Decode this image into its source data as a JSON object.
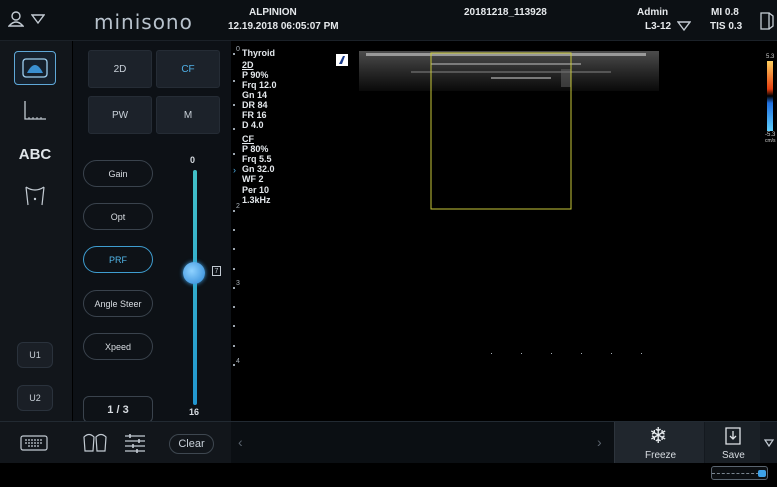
{
  "header": {
    "logo": "minisono",
    "company": "ALPINION",
    "datetime": "12.19.2018  06:05:07 PM",
    "study_id": "20181218_113928",
    "user": "Admin",
    "probe": "L3-12",
    "mi": "MI 0.8",
    "tis": "TIS 0.3"
  },
  "left_toolbar": {
    "abc_label": "ABC",
    "u1_label": "U1",
    "u2_label": "U2"
  },
  "modes": [
    "2D",
    "CF",
    "PW",
    "M"
  ],
  "controls": {
    "gain": "Gain",
    "opt": "Opt",
    "prf": "PRF",
    "angle_steer": "Angle Steer",
    "xpeed": "Xpeed",
    "page": "1 / 3",
    "depth_top": "0",
    "depth_bottom": "16",
    "slider_value_icon": "7"
  },
  "params": {
    "preset": "Thyroid",
    "p2d_title": "2D",
    "p2d_p": "P 90%",
    "p2d_frq": "Frq 12.0",
    "p2d_gn": "Gn 14",
    "p2d_dr": "DR 84",
    "p2d_fr": "FR 16",
    "p2d_d": "D 4.0",
    "cf_title": "CF",
    "cf_p": "P 80%",
    "cf_frq": "Frq 5.5",
    "cf_gn": "Gn 32.0",
    "cf_wf": "WF 2",
    "cf_per": "Per 10",
    "cf_prf": "1.3kHz",
    "depth_1": "0",
    "depth_2": "2",
    "depth_3": "3",
    "depth_4": "4"
  },
  "colorbar": {
    "top": "5.3",
    "bottom": "-5.3",
    "unit": "cm/s"
  },
  "bottom": {
    "clear": "Clear",
    "freeze": "Freeze",
    "save": "Save"
  },
  "colors": {
    "accent": "#3e9dd0",
    "roi_box": "#c8c83a",
    "slider": "#2aa7c0"
  },
  "icons": [
    "user-icon",
    "chevron-down-icon",
    "probe-icon",
    "measure-icon",
    "body-mark-icon",
    "keyboard-icon",
    "dual-view-icon",
    "list-icon",
    "snowflake-icon",
    "save-icon",
    "prev-icon",
    "next-icon"
  ]
}
